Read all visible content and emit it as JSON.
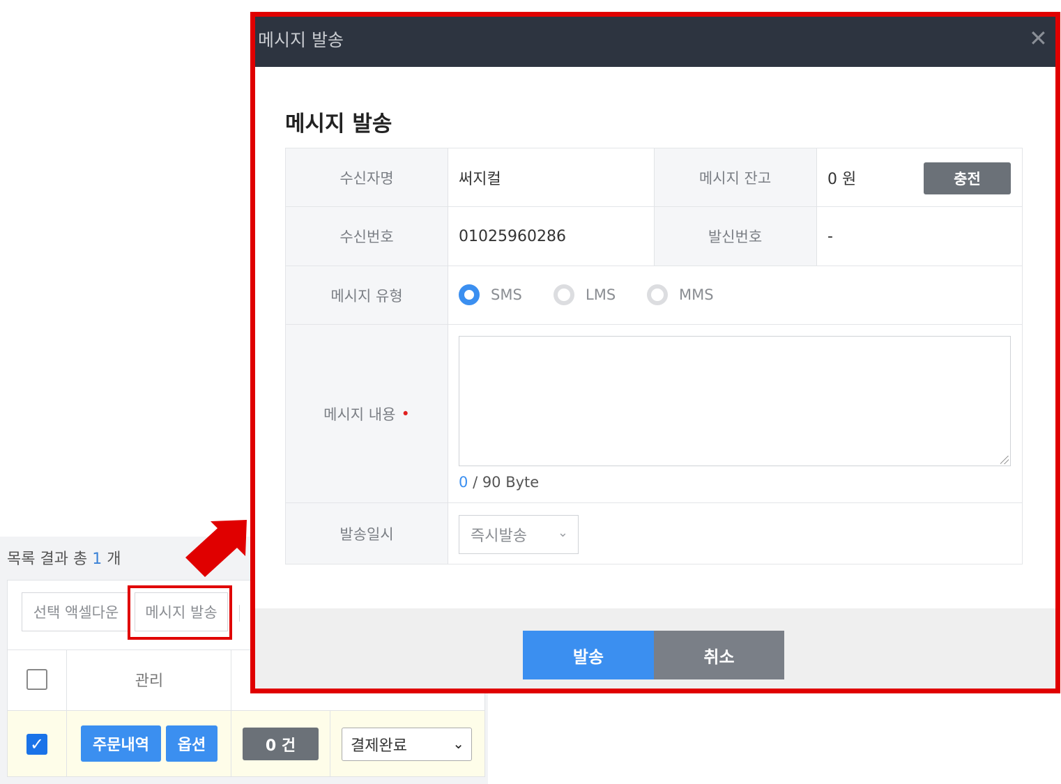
{
  "list": {
    "summary_prefix": "목록 결과 총",
    "summary_count": "1",
    "summary_suffix": "개",
    "toolbar": {
      "excel_label": "선택 액셀다운",
      "message_label": "메시지 발송"
    },
    "header": {
      "manage_label": "관리"
    },
    "row": {
      "order_btn": "주문내역",
      "option_btn": "옵션",
      "count_btn": "0 건",
      "status": "결제완료"
    }
  },
  "modal": {
    "header_title": "메시지 발송",
    "close_icon": "✕",
    "body_title": "메시지 발송",
    "fields": {
      "recipient_name_label": "수신자명",
      "recipient_name_value": "써지컬",
      "balance_label": "메시지 잔고",
      "balance_value": "0 원",
      "charge_button": "충전",
      "recipient_number_label": "수신번호",
      "recipient_number_value": "01025960286",
      "sender_number_label": "발신번호",
      "sender_number_value": "-",
      "type_label": "메시지 유형",
      "types": [
        "SMS",
        "LMS",
        "MMS"
      ],
      "selected_type": "SMS",
      "content_label": "메시지 내용",
      "required_mark": "•",
      "byte_current": "0",
      "byte_limit": "/ 90 Byte",
      "send_time_label": "발송일시",
      "send_time_value": "즉시발송"
    },
    "footer": {
      "send_button": "발송",
      "cancel_button": "취소"
    }
  },
  "colors": {
    "highlight": "#e00000",
    "primary": "#3b8ff0",
    "header_bg": "#2d3440"
  }
}
